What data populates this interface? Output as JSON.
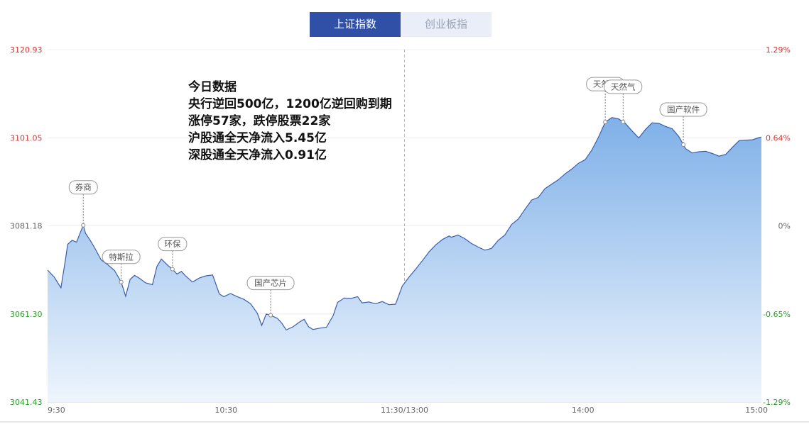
{
  "tabs": [
    {
      "label": "上证指数",
      "active": true
    },
    {
      "label": "创业板指",
      "active": false
    }
  ],
  "summary": {
    "title": "今日数据",
    "lines": [
      "央行逆回500亿，1200亿逆回购到期",
      "涨停57家，跌停股票22家",
      "沪股通全天净流入5.45亿",
      "深股通全天净流入0.91亿"
    ]
  },
  "colors": {
    "up": "#e03131",
    "down": "#2a9d2a",
    "neutral": "#666666",
    "line": "#3c5ea8",
    "fill_top": "#7fb0e8",
    "fill_bottom": "#eef5fd",
    "tab_active": "#2f50a6",
    "tab_inactive": "#e9eef8"
  },
  "chart_data": {
    "type": "area",
    "prev_close": 3081.18,
    "ylim": [
      3041.43,
      3120.93
    ],
    "left_ticks": [
      "3120.93",
      "3101.05",
      "3081.18",
      "3061.30",
      "3041.43"
    ],
    "right_ticks": [
      "1.29%",
      "0.64%",
      "0%",
      "-0.65%",
      "-1.29%"
    ],
    "x_ticks": [
      "9:30",
      "10:30",
      "11:30/13:00",
      "14:00",
      "15:00"
    ],
    "x_range_minutes": [
      0,
      240
    ],
    "series": [
      {
        "points": [
          [
            0,
            3071.2
          ],
          [
            3,
            3069.6
          ],
          [
            6,
            3067.2
          ],
          [
            8,
            3073.5
          ],
          [
            9,
            3077.0
          ],
          [
            11,
            3077.9
          ],
          [
            13,
            3077.5
          ],
          [
            15,
            3080.1
          ],
          [
            16,
            3081.3
          ],
          [
            17,
            3079.5
          ],
          [
            19,
            3078.0
          ],
          [
            21,
            3076.3
          ],
          [
            24,
            3073.5
          ],
          [
            27,
            3072.4
          ],
          [
            30,
            3071.1
          ],
          [
            33,
            3068.5
          ],
          [
            35,
            3065.3
          ],
          [
            37,
            3069.1
          ],
          [
            39,
            3070.0
          ],
          [
            41,
            3069.4
          ],
          [
            44,
            3068.3
          ],
          [
            47,
            3067.9
          ],
          [
            49,
            3072.0
          ],
          [
            51,
            3073.7
          ],
          [
            54,
            3072.2
          ],
          [
            56,
            3071.4
          ],
          [
            58,
            3070.3
          ],
          [
            60,
            3070.9
          ],
          [
            62,
            3069.8
          ],
          [
            65,
            3068.5
          ],
          [
            68,
            3069.4
          ],
          [
            71,
            3069.9
          ],
          [
            74,
            3070.1
          ],
          [
            77,
            3065.8
          ],
          [
            79,
            3065.2
          ],
          [
            82,
            3065.9
          ],
          [
            85,
            3065.2
          ],
          [
            88,
            3064.6
          ],
          [
            91,
            3063.6
          ],
          [
            94,
            3061.5
          ],
          [
            96,
            3058.7
          ],
          [
            98,
            3061.3
          ],
          [
            100,
            3061.0
          ],
          [
            103,
            3060.3
          ],
          [
            105,
            3059.2
          ],
          [
            107,
            3057.7
          ],
          [
            110,
            3058.4
          ],
          [
            113,
            3059.5
          ],
          [
            115,
            3060.1
          ],
          [
            117,
            3058.4
          ],
          [
            119,
            3057.8
          ],
          [
            122,
            3058.1
          ],
          [
            125,
            3058.3
          ],
          [
            128,
            3060.9
          ],
          [
            130,
            3063.9
          ],
          [
            133,
            3064.9
          ],
          [
            136,
            3064.8
          ],
          [
            139,
            3065.2
          ],
          [
            141,
            3063.8
          ],
          [
            144,
            3064.0
          ],
          [
            147,
            3063.6
          ],
          [
            150,
            3064.1
          ],
          [
            153,
            3063.4
          ],
          [
            156,
            3063.5
          ],
          [
            159,
            3067.6
          ],
          [
            162,
            3069.6
          ],
          [
            165,
            3071.4
          ],
          [
            168,
            3073.3
          ],
          [
            171,
            3075.3
          ],
          [
            174,
            3076.9
          ],
          [
            177,
            3078.1
          ],
          [
            180,
            3078.9
          ],
          [
            181,
            3078.6
          ],
          [
            184,
            3079.1
          ],
          [
            187,
            3078.3
          ],
          [
            190,
            3077.2
          ],
          [
            193,
            3076.4
          ],
          [
            196,
            3075.7
          ],
          [
            199,
            3076.1
          ],
          [
            202,
            3077.9
          ],
          [
            205,
            3079.1
          ],
          [
            208,
            3081.5
          ],
          [
            211,
            3082.7
          ],
          [
            214,
            3084.9
          ],
          [
            217,
            3087.0
          ],
          [
            220,
            3087.6
          ],
          [
            223,
            3089.6
          ],
          [
            226,
            3090.6
          ],
          [
            229,
            3091.6
          ],
          [
            232,
            3092.9
          ],
          [
            235,
            3094.0
          ],
          [
            238,
            3095.3
          ],
          [
            241,
            3096.1
          ],
          [
            244,
            3098.3
          ],
          [
            247,
            3101.2
          ],
          [
            250,
            3104.6
          ],
          [
            253,
            3105.6
          ],
          [
            256,
            3105.3
          ],
          [
            259,
            3104.3
          ],
          [
            262,
            3102.6
          ],
          [
            265,
            3101.0
          ],
          [
            268,
            3102.9
          ],
          [
            271,
            3104.4
          ],
          [
            274,
            3104.3
          ],
          [
            277,
            3103.6
          ],
          [
            280,
            3103.1
          ],
          [
            283,
            3101.3
          ],
          [
            286,
            3098.6
          ],
          [
            289,
            3097.6
          ],
          [
            292,
            3097.9
          ],
          [
            295,
            3098.0
          ],
          [
            298,
            3097.5
          ],
          [
            301,
            3096.9
          ],
          [
            304,
            3097.3
          ],
          [
            307,
            3098.9
          ],
          [
            310,
            3100.4
          ],
          [
            313,
            3100.5
          ],
          [
            316,
            3100.6
          ],
          [
            319,
            3101.1
          ],
          [
            320,
            3101.2
          ]
        ],
        "tags": [
          {
            "label": "券商",
            "t": 16
          },
          {
            "label": "特斯拉",
            "t": 33
          },
          {
            "label": "环保",
            "t": 56
          },
          {
            "label": "国产芯片",
            "t": 100
          },
          {
            "label": "天然气",
            "t": 250
          },
          {
            "label": "天然气",
            "t": 258
          },
          {
            "label": "国产软件",
            "t": 285
          }
        ]
      }
    ]
  }
}
